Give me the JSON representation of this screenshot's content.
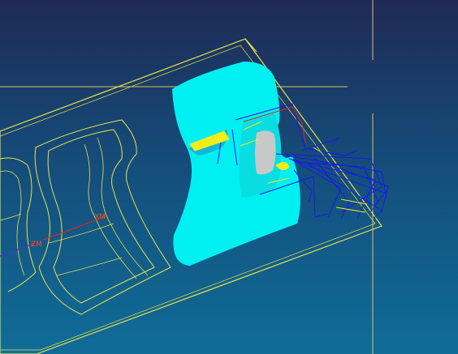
{
  "app": {
    "view": "cam-toolpath-3d-viewport"
  },
  "colors": {
    "background_top": "#1f2a55",
    "background_mid": "#154c7a",
    "background_bottom": "#0f6d98",
    "stock_outline": "#e6e24a",
    "part_surface": "#00f0f2",
    "toolpath_blue": "#1a1ae6",
    "toolpath_yellow": "#f2ec1a",
    "crosshair": "#e0c060",
    "axis_red": "#e0281e",
    "axis_label": "#e05a1e",
    "face_gray": "#c8c8c8"
  },
  "axes": {
    "x_label": "XM",
    "z_label": "ZM"
  },
  "icons": [
    "crosshair-icon",
    "axis-triad-icon"
  ]
}
